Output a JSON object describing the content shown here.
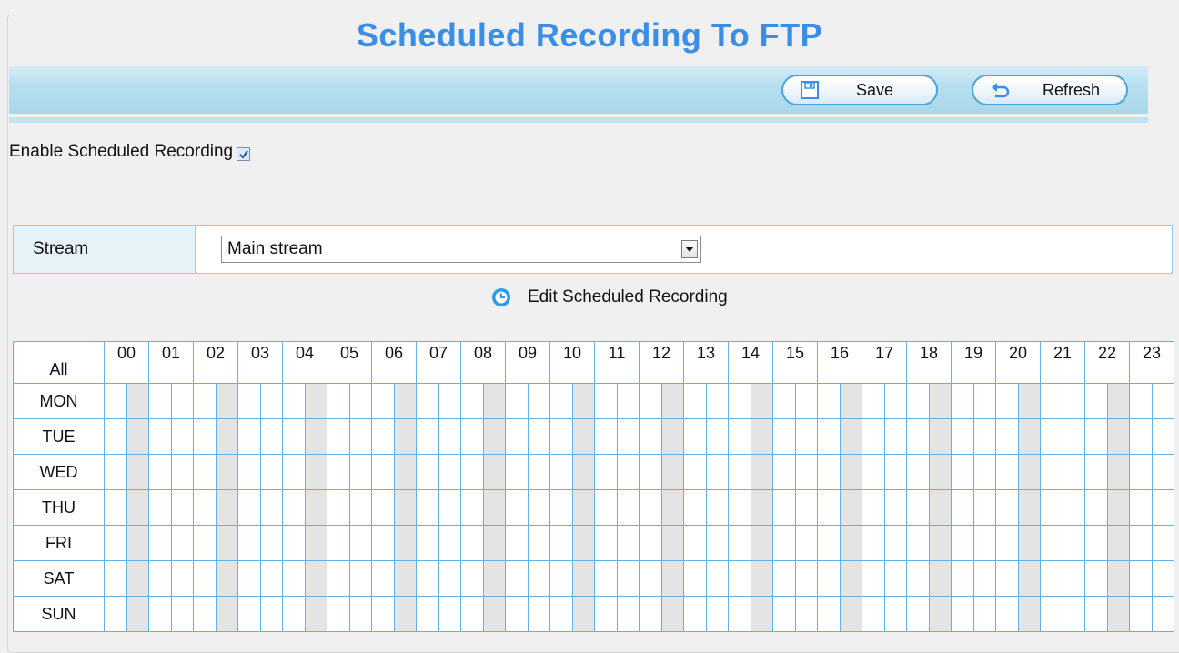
{
  "page": {
    "title": "Scheduled Recording To FTP"
  },
  "toolbar": {
    "save_label": "Save",
    "save_icon": "floppy-disk-icon",
    "refresh_label": "Refresh",
    "refresh_icon": "refresh-arrow-icon"
  },
  "enable": {
    "label": "Enable Scheduled Recording",
    "checked": true
  },
  "stream": {
    "label": "Stream",
    "selected": "Main stream"
  },
  "edit": {
    "label": "Edit Scheduled Recording",
    "icon": "clock-icon"
  },
  "schedule": {
    "all_label": "All",
    "hours": [
      "00",
      "01",
      "02",
      "03",
      "04",
      "05",
      "06",
      "07",
      "08",
      "09",
      "10",
      "11",
      "12",
      "13",
      "14",
      "15",
      "16",
      "17",
      "18",
      "19",
      "20",
      "21",
      "22",
      "23"
    ],
    "days": [
      "MON",
      "TUE",
      "WED",
      "THU",
      "FRI",
      "SAT",
      "SUN"
    ]
  },
  "colors": {
    "accent": "#3a8ee6",
    "grid_line": "#62b2e2",
    "toolbar": "#b7dfee",
    "shaded_cell": "#e4e4e4"
  }
}
